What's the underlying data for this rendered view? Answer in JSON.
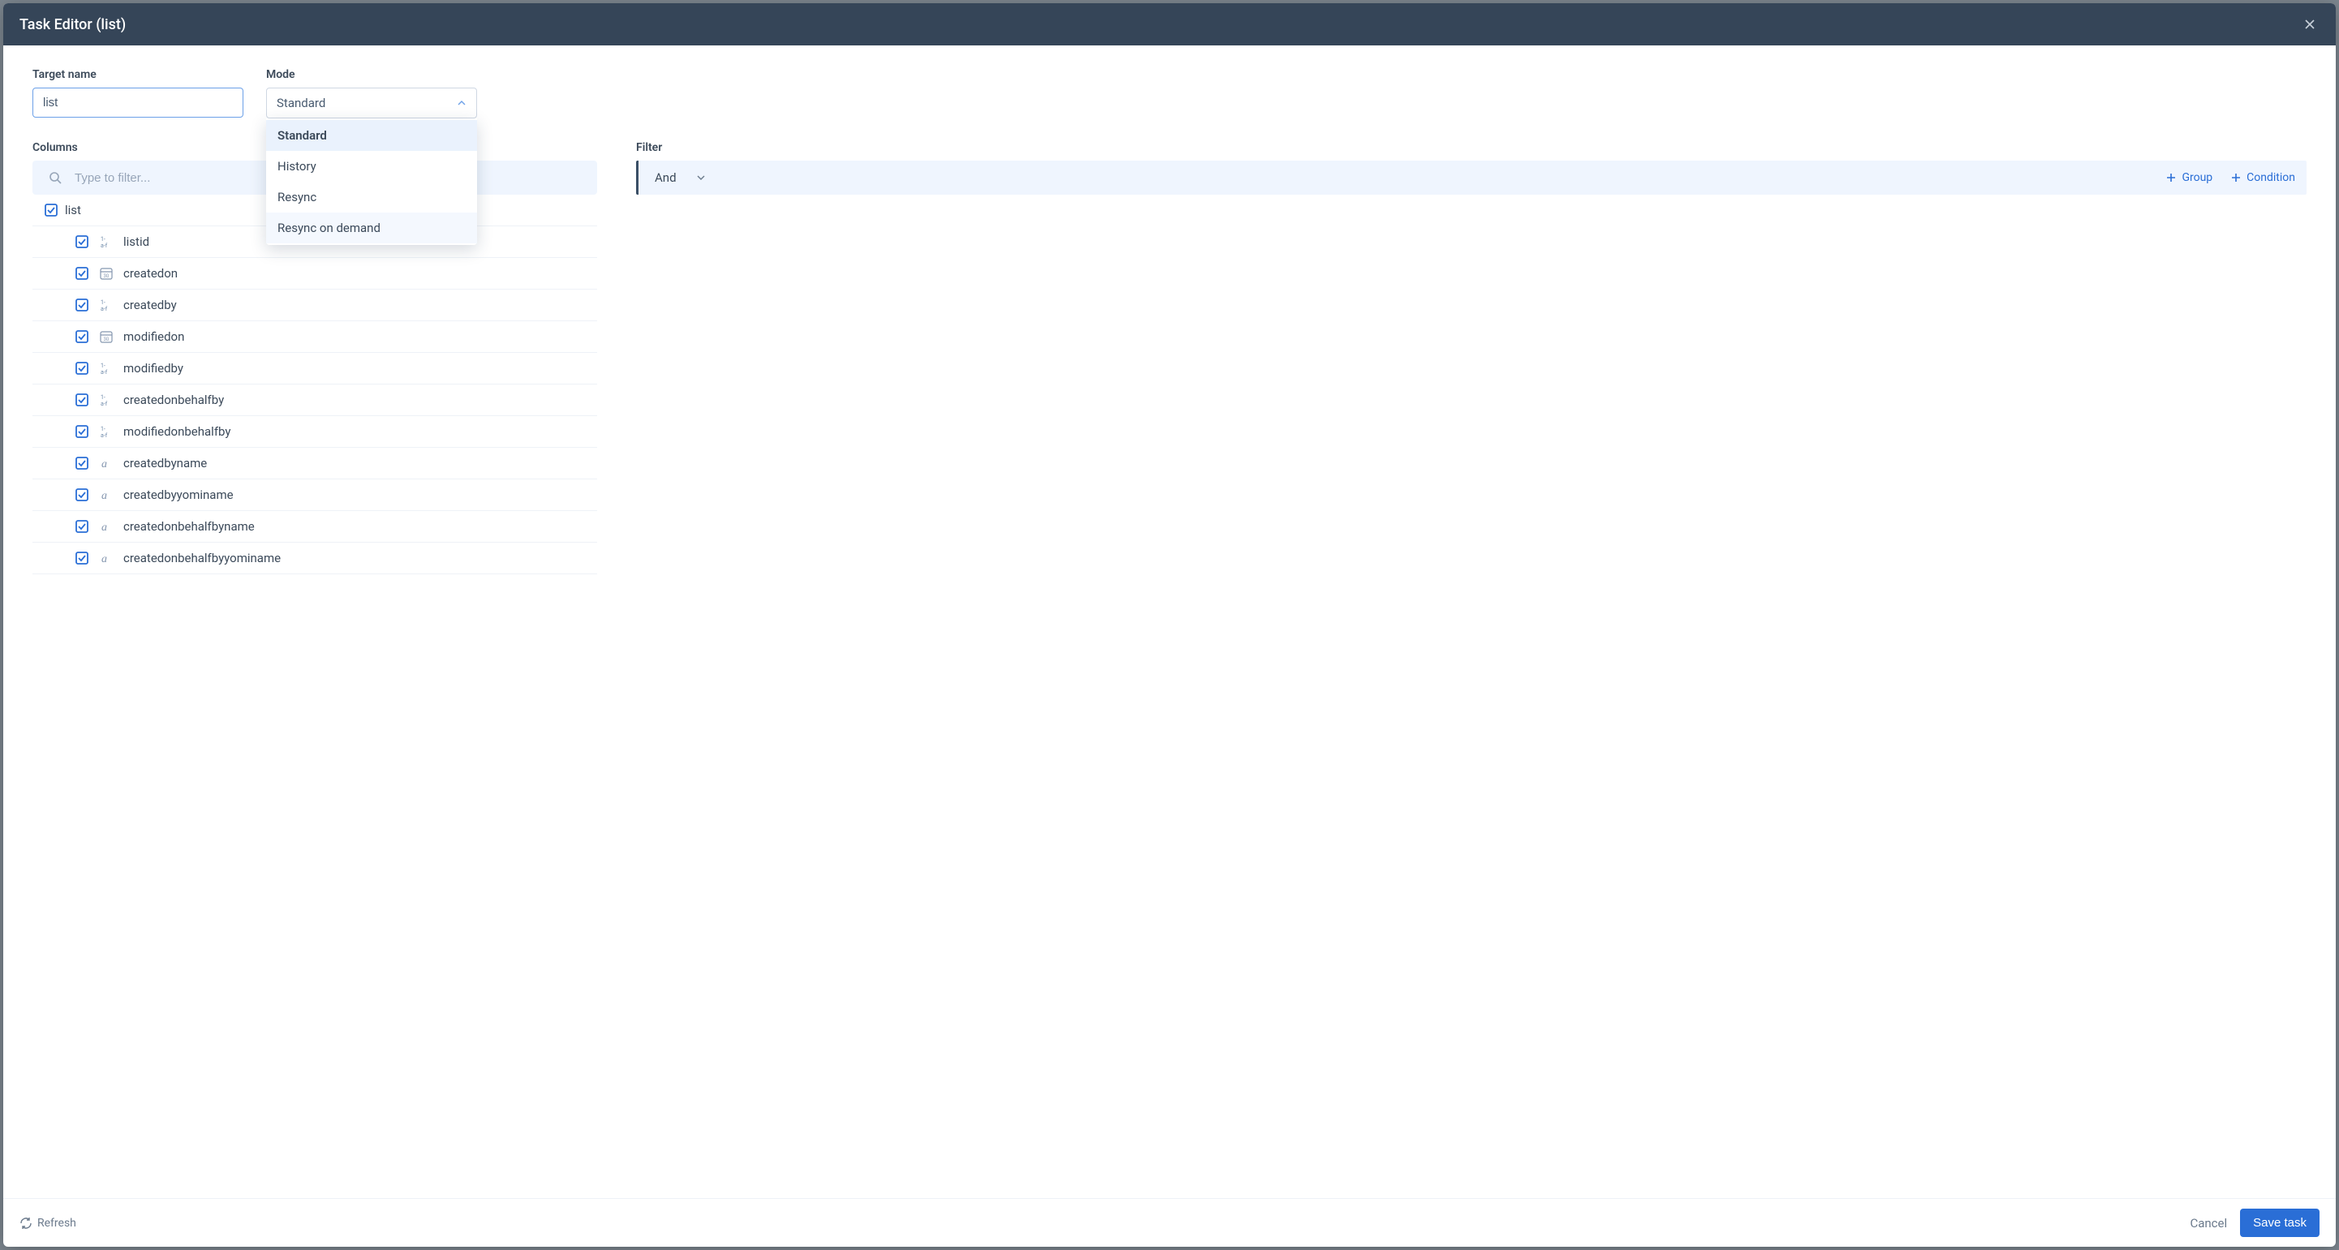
{
  "header": {
    "title": "Task Editor (list)"
  },
  "targetName": {
    "label": "Target name",
    "value": "list"
  },
  "mode": {
    "label": "Mode",
    "selected": "Standard",
    "options": [
      "Standard",
      "History",
      "Resync",
      "Resync on demand"
    ],
    "selected_index": 0,
    "hover_index": 3
  },
  "columns": {
    "label": "Columns",
    "filter_placeholder": "Type to filter...",
    "root": "list",
    "items": [
      {
        "name": "listid",
        "type": "key",
        "checked": true
      },
      {
        "name": "createdon",
        "type": "date",
        "checked": true
      },
      {
        "name": "createdby",
        "type": "key",
        "checked": true
      },
      {
        "name": "modifiedon",
        "type": "date",
        "checked": true
      },
      {
        "name": "modifiedby",
        "type": "key",
        "checked": true
      },
      {
        "name": "createdonbehalfby",
        "type": "key",
        "checked": true
      },
      {
        "name": "modifiedonbehalfby",
        "type": "key",
        "checked": true
      },
      {
        "name": "createdbyname",
        "type": "text",
        "checked": true
      },
      {
        "name": "createdbyyominame",
        "type": "text",
        "checked": true
      },
      {
        "name": "createdonbehalfbyname",
        "type": "text",
        "checked": true
      },
      {
        "name": "createdonbehalfbyyominame",
        "type": "text",
        "checked": true
      }
    ]
  },
  "filter": {
    "label": "Filter",
    "root_op": "And",
    "group_label": "Group",
    "condition_label": "Condition"
  },
  "footer": {
    "refresh": "Refresh",
    "cancel": "Cancel",
    "save": "Save task"
  }
}
